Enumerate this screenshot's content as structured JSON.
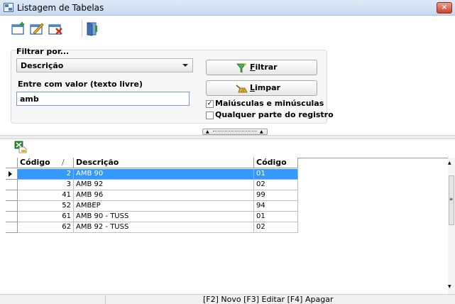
{
  "window": {
    "title": "Listagem de Tabelas",
    "close_glyph": "×"
  },
  "toolbar": {
    "buttons": [
      {
        "icon": "new-record-icon"
      },
      {
        "icon": "edit-record-icon"
      },
      {
        "icon": "delete-record-icon"
      },
      {
        "icon": "exit-door-icon"
      }
    ]
  },
  "filter": {
    "group_label": "Filtrar por...",
    "field_selected": "Descrição",
    "value_label": "Entre com valor (texto livre)",
    "value": "amb",
    "filter_button_prefix": "",
    "filter_button_accel": "F",
    "filter_button_rest": "iltrar",
    "clear_button_accel": "L",
    "clear_button_rest": "impar",
    "case_sensitive_label": "Maiúsculas e minúsculas",
    "case_sensitive_checked": "✓",
    "any_part_label": "Qualquer parte do registro",
    "any_part_checked": ""
  },
  "grid": {
    "columns": [
      {
        "label": "Código",
        "sort_glyph": "/"
      },
      {
        "label": "Descrição"
      },
      {
        "label": "Código ANS"
      }
    ],
    "rows": [
      {
        "codigo": "2",
        "descricao": "AMB 90",
        "ans": "01"
      },
      {
        "codigo": "3",
        "descricao": "AMB 92",
        "ans": "02"
      },
      {
        "codigo": "41",
        "descricao": "AMB 96",
        "ans": "99"
      },
      {
        "codigo": "52",
        "descricao": "AMBEP",
        "ans": "94"
      },
      {
        "codigo": "61",
        "descricao": "AMB 90 - TUSS",
        "ans": "01"
      },
      {
        "codigo": "62",
        "descricao": "AMB 92 - TUSS",
        "ans": "02"
      }
    ],
    "selected_row": 0
  },
  "status": {
    "hint": "[F2] Novo [F3] Editar [F4] Apagar"
  },
  "colors": {
    "selection": "#3399ff",
    "title_bar": "#c9daf0"
  }
}
